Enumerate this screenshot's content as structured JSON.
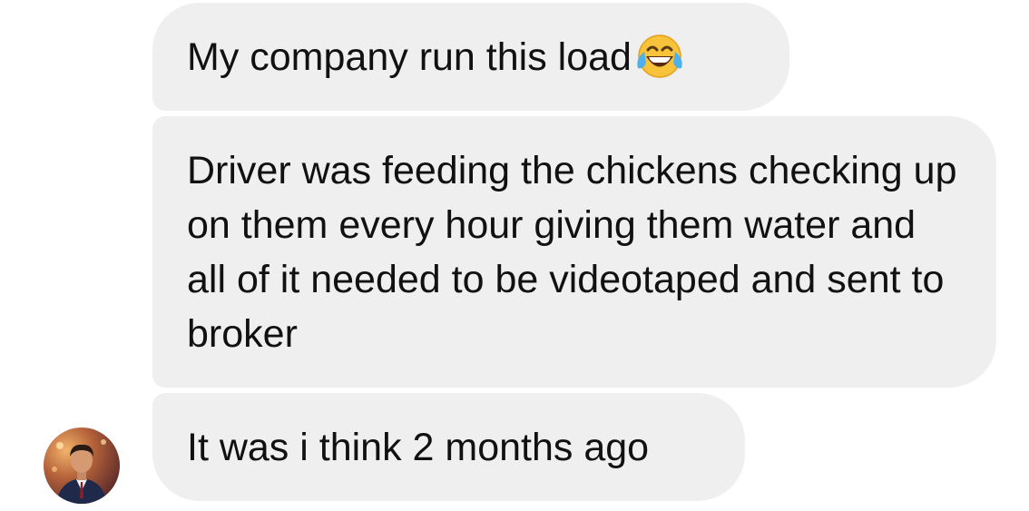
{
  "messages": [
    {
      "text": "My company run this load",
      "emoji": "face-with-tears-of-joy-icon"
    },
    {
      "text": "Driver was feeding the chickens checking up on them every hour giving them water and all of it needed to be videotaped and sent to broker"
    },
    {
      "text": "It was i think 2 months ago"
    }
  ],
  "colors": {
    "bubble_background": "#efefef",
    "text": "#111111",
    "background": "#ffffff"
  }
}
